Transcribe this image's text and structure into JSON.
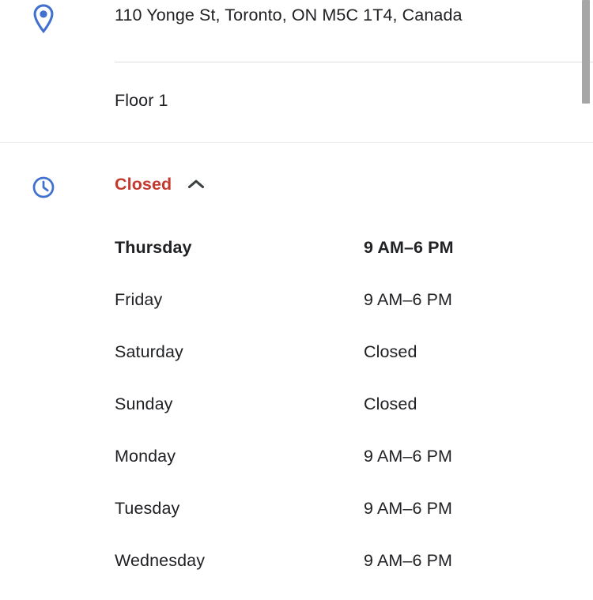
{
  "place": {
    "address": {
      "icon": "location-pin-icon",
      "text": "110 Yonge St, Toronto, ON M5C 1T4, Canada"
    },
    "floor": {
      "text": "Floor 1"
    },
    "hours": {
      "icon": "clock-icon",
      "status_label": "Closed",
      "status_color": "#c5392f",
      "toggle_icon": "chevron-up-icon",
      "expanded": true,
      "schedule": [
        {
          "day": "Thursday",
          "time": "9 AM–6 PM",
          "today": true
        },
        {
          "day": "Friday",
          "time": "9 AM–6 PM",
          "today": false
        },
        {
          "day": "Saturday",
          "time": "Closed",
          "today": false
        },
        {
          "day": "Sunday",
          "time": "Closed",
          "today": false
        },
        {
          "day": "Monday",
          "time": "9 AM–6 PM",
          "today": false
        },
        {
          "day": "Tuesday",
          "time": "9 AM–6 PM",
          "today": false
        },
        {
          "day": "Wednesday",
          "time": "9 AM–6 PM",
          "today": false
        }
      ]
    }
  },
  "theme": {
    "accent_blue": "#4171cf",
    "text_primary": "#202124",
    "divider": "#dadce0",
    "scrollbar": "#a6a6a6"
  },
  "scrollbar": {
    "name": "vertical-scrollbar"
  }
}
